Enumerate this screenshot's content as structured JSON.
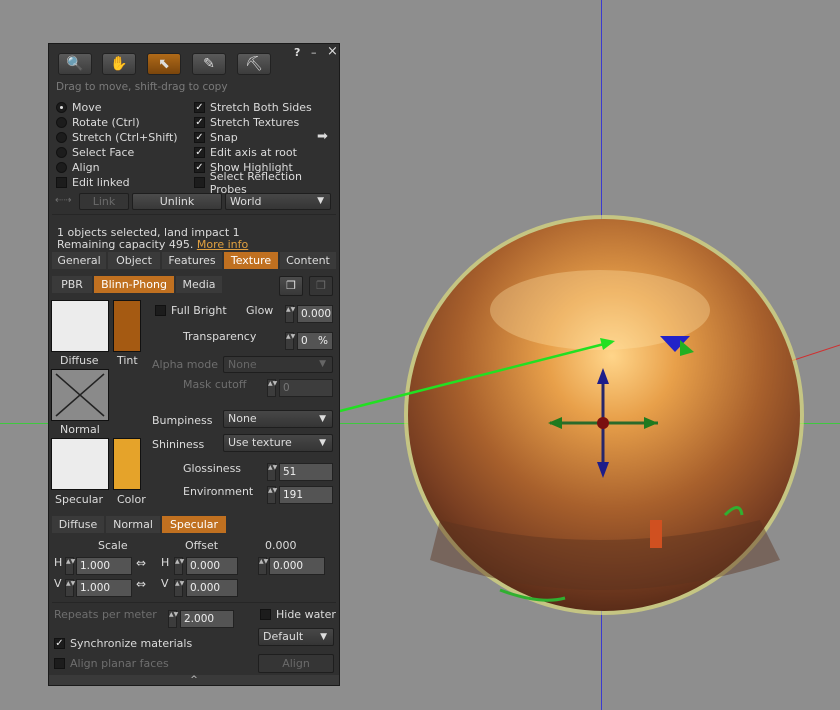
{
  "toolbar": {
    "tools": [
      "focus-icon",
      "hand-icon",
      "pointer-icon",
      "wrench-icon",
      "bulldozer-icon"
    ],
    "help": "?",
    "minimize": "–",
    "close": "×",
    "hint": "Drag to move, shift-drag to copy"
  },
  "modes": [
    {
      "label": "Move",
      "selected": true
    },
    {
      "label": "Rotate (Ctrl)",
      "selected": false
    },
    {
      "label": "Stretch (Ctrl+Shift)",
      "selected": false
    },
    {
      "label": "Select Face",
      "selected": false
    },
    {
      "label": "Align",
      "selected": false
    }
  ],
  "edit_linked": "Edit linked",
  "options": [
    {
      "label": "Stretch Both Sides",
      "checked": true
    },
    {
      "label": "Stretch Textures",
      "checked": true
    },
    {
      "label": "Snap",
      "checked": true
    },
    {
      "label": "Edit axis at root",
      "checked": true
    },
    {
      "label": "Show Highlight",
      "checked": true
    },
    {
      "label": "Select Reflection Probes",
      "checked": false
    }
  ],
  "link_row": {
    "link": "Link",
    "unlink": "Unlink",
    "coord": "World"
  },
  "selection": {
    "line1": "1 objects selected, land impact 1",
    "line2": "Remaining capacity 495.",
    "more": "More info"
  },
  "tabs": [
    "General",
    "Object",
    "Features",
    "Texture",
    "Content"
  ],
  "active_tab": "Texture",
  "subtabs": [
    "PBR",
    "Blinn-Phong",
    "Media"
  ],
  "labels": {
    "diffuse": "Diffuse",
    "tint": "Tint",
    "normal": "Normal",
    "specular": "Specular",
    "color": "Color",
    "full_bright": "Full Bright",
    "glow": "Glow",
    "transparency": "Transparency",
    "alpha_mode": "Alpha mode",
    "mask_cutoff": "Mask cutoff",
    "bumpiness": "Bumpiness",
    "shininess": "Shininess",
    "glossiness": "Glossiness",
    "environment": "Environment",
    "percent": "%"
  },
  "values": {
    "glow": "0.000",
    "transparency": "0",
    "alpha_mode": "None",
    "mask_cutoff": "0",
    "bumpiness": "None",
    "shininess": "Use texture",
    "glossiness": "51",
    "environment": "191"
  },
  "map_tabs": [
    "Diffuse",
    "Normal",
    "Specular"
  ],
  "transform": {
    "scale": "Scale",
    "offset": "Offset",
    "rotation": "0.000",
    "h": "H",
    "v": "V",
    "scale_h": "1.000",
    "scale_v": "1.000",
    "offset_h": "0.000",
    "offset_v": "0.000"
  },
  "footer": {
    "repeats_label": "Repeats per meter",
    "repeats": "2.000",
    "hide_water": "Hide water",
    "mapping": "Default",
    "sync": "Synchronize materials",
    "align_planar": "Align planar faces",
    "align": "Align",
    "expand": "^"
  },
  "colors": {
    "accent": "#c07020",
    "tint": "#a55a12",
    "spec_color": "#e5a32a"
  }
}
